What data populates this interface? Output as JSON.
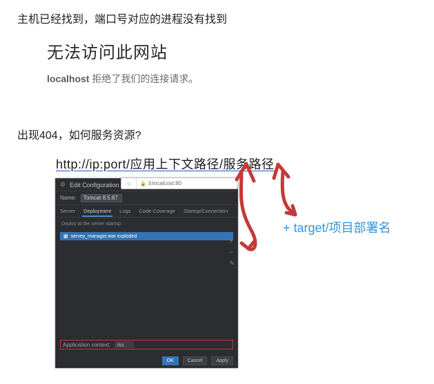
{
  "section1": {
    "title": "主机已经找到，端口号对应的进程没有找到",
    "error_heading": "无法访问此网站",
    "error_host": "localhost",
    "error_rest": " 拒绝了我们的连接请求。"
  },
  "section2": {
    "title": "出现404，如何服务资源?",
    "url_example": "http://ip:port/应用上下文路径/服务路径",
    "annotation": "+ target/项目部署名"
  },
  "addrbar": {
    "lock_glyph": "🔒",
    "back_glyph": "◁",
    "text": "①localcost:80"
  },
  "ide": {
    "gear_glyph": "⚙",
    "title": "Edit Configuration",
    "name_label": "Name:",
    "name_value": "Tomcat 8.5.87",
    "tabs": {
      "server": "Server",
      "deployment": "Deployment",
      "logs": "Logs",
      "code_coverage": "Code Coverage",
      "startup": "Startup/Connection"
    },
    "hint": "Deploy at the server startup",
    "deploy_item": "servey_manager:war exploded",
    "side": {
      "plus": "+",
      "minus": "−",
      "pencil": "✎"
    },
    "app_ctx_label": "Application context:",
    "app_ctx_value": "/ss",
    "buttons": {
      "ok": "OK",
      "cancel": "Cancel",
      "apply": "Apply"
    }
  }
}
